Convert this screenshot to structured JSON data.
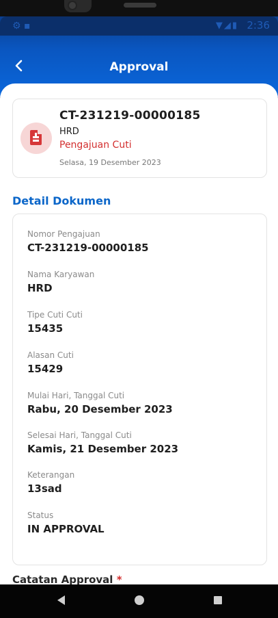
{
  "status_bar": {
    "time": "2:36"
  },
  "header": {
    "title": "Approval"
  },
  "summary": {
    "code": "CT-231219-00000185",
    "employee": "HRD",
    "type": "Pengajuan Cuti",
    "date": "Selasa, 19 Desember 2023"
  },
  "detail": {
    "section_title": "Detail Dokumen",
    "fields": [
      {
        "label": "Nomor Pengajuan",
        "value": "CT-231219-00000185"
      },
      {
        "label": "Nama Karyawan",
        "value": "HRD"
      },
      {
        "label": "Tipe Cuti Cuti",
        "value": "15435"
      },
      {
        "label": "Alasan Cuti",
        "value": "15429"
      },
      {
        "label": "Mulai Hari, Tanggal Cuti",
        "value": "Rabu, 20 Desember 2023"
      },
      {
        "label": "Selesai Hari, Tanggal Cuti",
        "value": "Kamis, 21 Desember 2023"
      },
      {
        "label": "Keterangan",
        "value": "13sad"
      },
      {
        "label": "Status",
        "value": "IN APPROVAL"
      }
    ]
  },
  "approval_notes": {
    "label": "Catatan Approval",
    "required_mark": "*"
  },
  "colors": {
    "primary": "#0a67dc",
    "accent_red": "#d32f2f",
    "section_blue": "#0b66c9"
  },
  "icons": {
    "back": "chevron-left-icon",
    "document": "document-icon"
  }
}
